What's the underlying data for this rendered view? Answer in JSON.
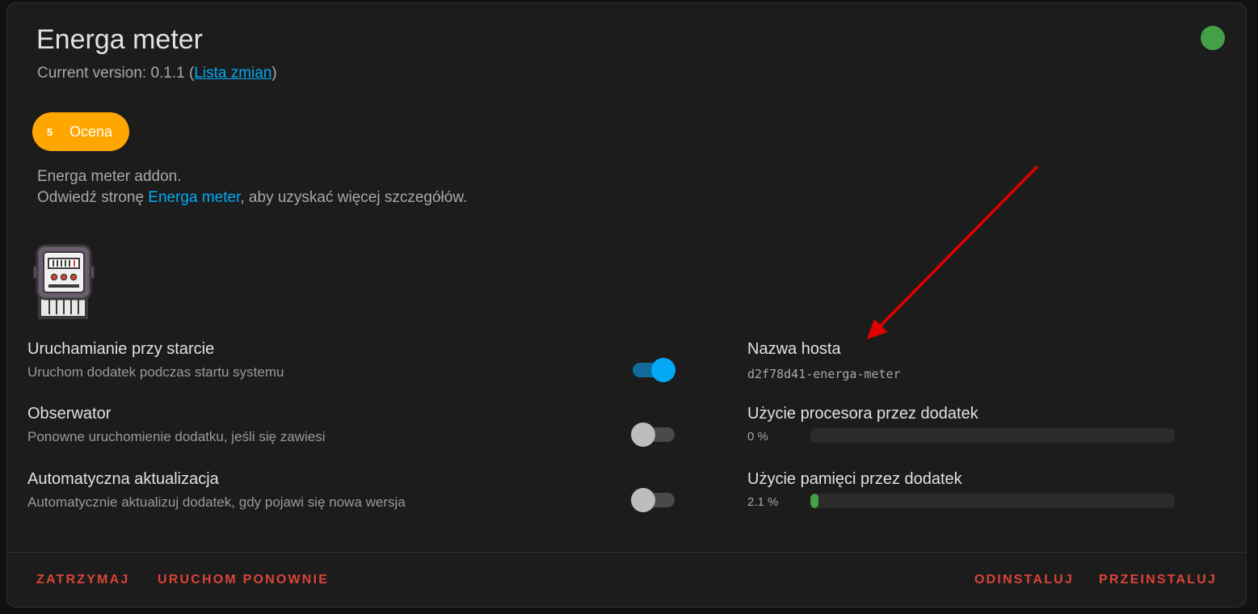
{
  "header": {
    "title": "Energa meter",
    "version_prefix": "Current version: 0.1.1 (",
    "changelog_link": "Lista zmian",
    "version_suffix": ")",
    "status_color": "#43a047"
  },
  "rating": {
    "score": "5",
    "label": "Ocena",
    "color": "#ffa600"
  },
  "description": {
    "line1": "Energa meter addon.",
    "line2_prefix": "Odwiedź stronę ",
    "line2_link": "Energa meter",
    "line2_suffix": ", aby uzyskać więcej szczegółów."
  },
  "addon_icon": "electric-meter-icon",
  "options": [
    {
      "title": "Uruchamianie przy starcie",
      "subtitle": "Uruchom dodatek podczas startu systemu",
      "enabled": true
    },
    {
      "title": "Obserwator",
      "subtitle": "Ponowne uruchomienie dodatku, jeśli się zawiesi",
      "enabled": false
    },
    {
      "title": "Automatyczna aktualizacja",
      "subtitle": "Automatycznie aktualizuj dodatek, gdy pojawi się nowa wersja",
      "enabled": false
    }
  ],
  "info": {
    "hostname_label": "Nazwa hosta",
    "hostname_value": "d2f78d41-energa-meter",
    "cpu_label": "Użycie procesora przez dodatek",
    "cpu_value": "0 %",
    "cpu_fraction": 0,
    "memory_label": "Użycie pamięci przez dodatek",
    "memory_value": "2.1 %",
    "memory_fraction": 0.021
  },
  "actions": {
    "stop": "ZATRZYMAJ",
    "restart": "URUCHOM PONOWNIE",
    "uninstall": "ODINSTALUJ",
    "rebuild": "PRZEINSTALUJ",
    "color": "#db4437"
  },
  "accent_color": "#03a9f4",
  "annotation_arrow_color": "#e00000"
}
